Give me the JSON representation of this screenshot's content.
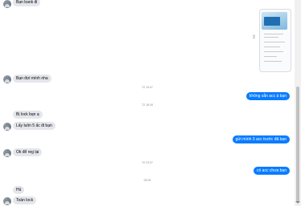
{
  "messages": {
    "m1": "Bạn bank đi",
    "m2": "Bạn đợi mình nha",
    "ts1": "T2 19:47",
    "m3": "không sẵn acc à bạn",
    "ts2": "T2 18:18",
    "m4": "Bị lock bạn ạ",
    "m5": "Lấy luôn 5 ấc đi bạn",
    "m6": "gửi mình 3 acc trước đã bạn",
    "m7": "Ok để reg lại",
    "ts3": "T2 23:37",
    "m8": "có acc chưa bạn",
    "ts4": "05:05",
    "m9": "Hú",
    "m10": "Toàn lock"
  },
  "colors": {
    "outgoing_bubble": "#0a7cff",
    "incoming_bubble": "#e4e6eb",
    "timestamp": "#8a8d91"
  },
  "icons": [
    "avatar",
    "share-icon",
    "scroll-down-arrow-icon"
  ]
}
